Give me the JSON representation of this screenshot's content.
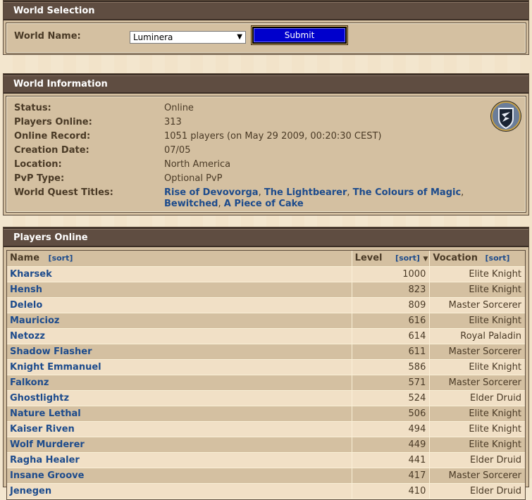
{
  "world_selection": {
    "title": "World Selection",
    "label": "World Name:",
    "selected_world": "Luminera",
    "submit_label": "Submit"
  },
  "world_information": {
    "title": "World Information",
    "rows": [
      {
        "label": "Status:",
        "value": "Online"
      },
      {
        "label": "Players Online:",
        "value": "313"
      },
      {
        "label": "Online Record:",
        "value": "1051 players (on May 29 2009, 00:20:30 CEST)"
      },
      {
        "label": "Creation Date:",
        "value": "07/05"
      },
      {
        "label": "Location:",
        "value": "North America"
      },
      {
        "label": "PvP Type:",
        "value": "Optional PvP"
      }
    ],
    "quest_label": "World Quest Titles:",
    "quests": [
      "Rise of Devovorga",
      "The Lightbearer",
      "The Colours of Magic",
      "Bewitched",
      "A Piece of Cake"
    ],
    "badge_icon": "optional-pvp-shield-icon"
  },
  "players_online": {
    "title": "Players Online",
    "col_name": "Name",
    "col_level": "Level",
    "col_vocation": "Vocation",
    "sort_label": "sort",
    "sort_indicator": "▼",
    "rows": [
      {
        "name": "Kharsek",
        "level": "1000",
        "vocation": "Elite Knight"
      },
      {
        "name": "Hensh",
        "level": "823",
        "vocation": "Elite Knight"
      },
      {
        "name": "Delelo",
        "level": "809",
        "vocation": "Master Sorcerer"
      },
      {
        "name": "Mauricioz",
        "level": "616",
        "vocation": "Elite Knight"
      },
      {
        "name": "Netozz",
        "level": "614",
        "vocation": "Royal Paladin"
      },
      {
        "name": "Shadow Flasher",
        "level": "611",
        "vocation": "Master Sorcerer"
      },
      {
        "name": "Knight Emmanuel",
        "level": "586",
        "vocation": "Elite Knight"
      },
      {
        "name": "Falkonz",
        "level": "571",
        "vocation": "Master Sorcerer"
      },
      {
        "name": "Ghostlightz",
        "level": "524",
        "vocation": "Elder Druid"
      },
      {
        "name": "Nature Lethal",
        "level": "506",
        "vocation": "Elite Knight"
      },
      {
        "name": "Kaiser Riven",
        "level": "494",
        "vocation": "Elite Knight"
      },
      {
        "name": "Wolf Murderer",
        "level": "449",
        "vocation": "Elite Knight"
      },
      {
        "name": "Ragha Healer",
        "level": "441",
        "vocation": "Elder Druid"
      },
      {
        "name": "Insane Groove",
        "level": "417",
        "vocation": "Master Sorcerer"
      },
      {
        "name": "Jenegen",
        "level": "410",
        "vocation": "Elder Druid"
      }
    ]
  },
  "colors": {
    "header_bg": "#5f4d41",
    "box_bg": "#d4c0a1",
    "row_light": "#f1e0c6",
    "link": "#1d4b8c",
    "submit_bg": "#0000cc"
  }
}
